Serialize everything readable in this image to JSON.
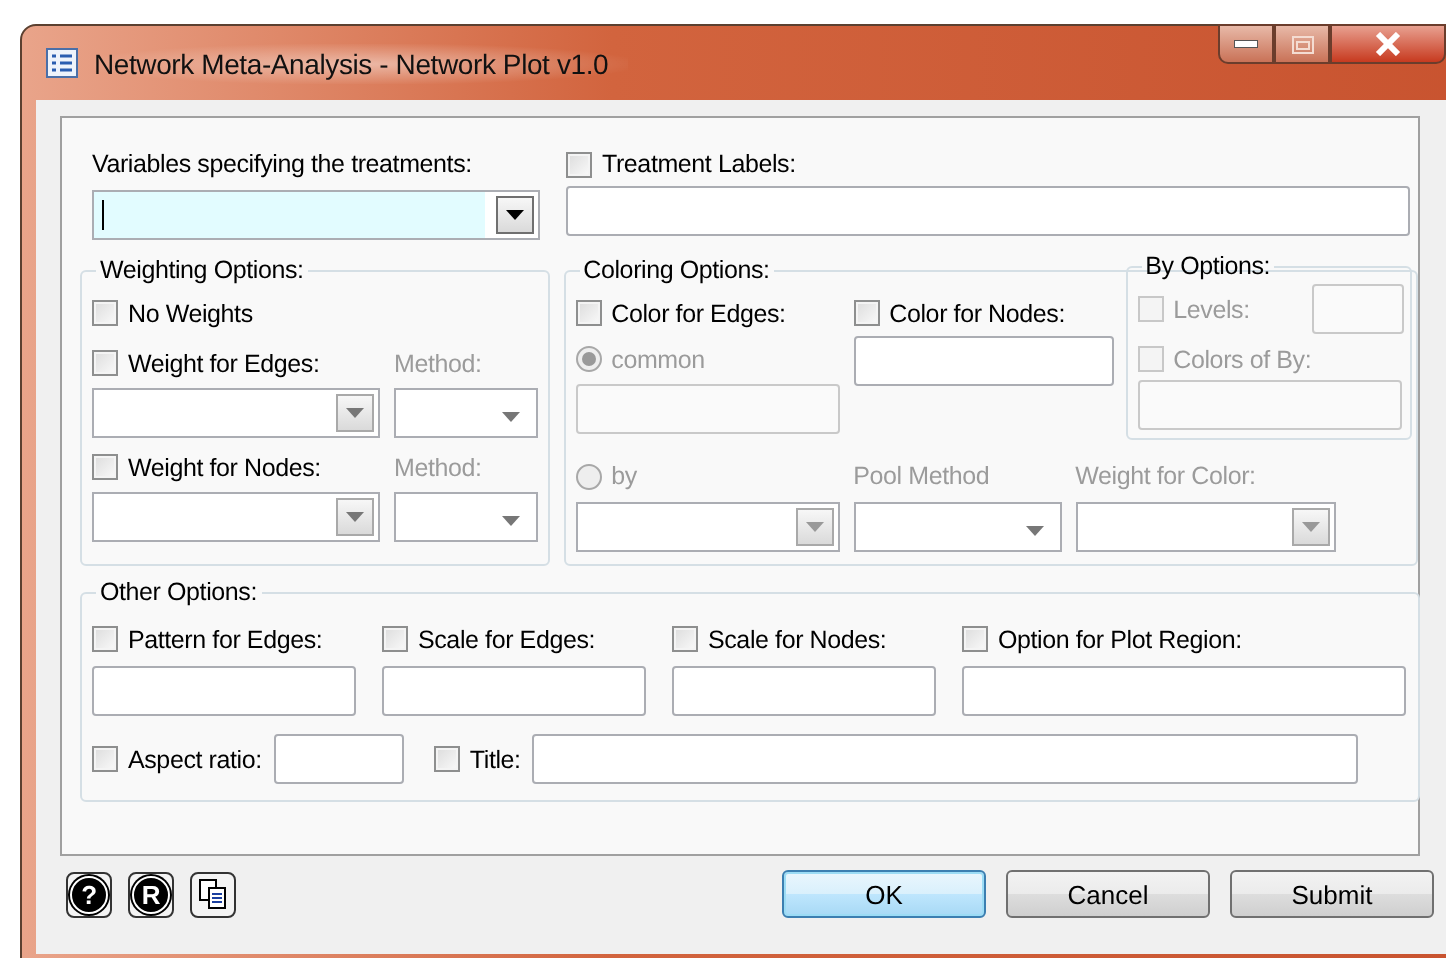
{
  "window": {
    "title": "Network Meta-Analysis - Network Plot v1.0"
  },
  "treatments": {
    "label": "Variables specifying the treatments:",
    "focused": true
  },
  "treatment_labels": {
    "label": "Treatment Labels:",
    "checked": false
  },
  "weighting": {
    "title": "Weighting Options:",
    "no_weights": {
      "label": "No Weights",
      "checked": false
    },
    "edges": {
      "label": "Weight for Edges:",
      "checked": false,
      "method_label": "Method:"
    },
    "nodes": {
      "label": "Weight for Nodes:",
      "checked": false,
      "method_label": "Method:"
    }
  },
  "coloring": {
    "title": "Coloring Options:",
    "edges": {
      "label": "Color for Edges:",
      "checked": false
    },
    "nodes": {
      "label": "Color for Nodes:",
      "checked": false
    },
    "common": {
      "label": "common",
      "selected": true,
      "disabled": true
    },
    "by": {
      "label": "by",
      "selected": false,
      "disabled": true
    },
    "pool_method": {
      "label": "Pool Method",
      "disabled": true
    },
    "weight_color": {
      "label": "Weight for Color:",
      "disabled": true
    }
  },
  "by_options": {
    "title": "By Options:",
    "levels": {
      "label": "Levels:",
      "checked": false,
      "disabled": true
    },
    "colors": {
      "label": "Colors of By:",
      "checked": false,
      "disabled": true
    }
  },
  "other": {
    "title": "Other Options:",
    "fields": [
      {
        "label": "Pattern for Edges:",
        "checked": false
      },
      {
        "label": "Scale for Edges:",
        "checked": false
      },
      {
        "label": "Scale for Nodes:",
        "checked": false
      },
      {
        "label": "Option for Plot Region:",
        "checked": false
      }
    ],
    "aspect": {
      "label": "Aspect ratio:",
      "checked": false
    },
    "title_option": {
      "label": "Title:",
      "checked": false
    }
  },
  "footer_icons": [
    {
      "kind": "help",
      "text": "?"
    },
    {
      "kind": "r",
      "text": "R"
    },
    {
      "kind": "copy"
    }
  ],
  "buttons": [
    {
      "label": "OK",
      "default": true
    },
    {
      "label": "Cancel",
      "default": false
    },
    {
      "label": "Submit",
      "default": false
    }
  ]
}
